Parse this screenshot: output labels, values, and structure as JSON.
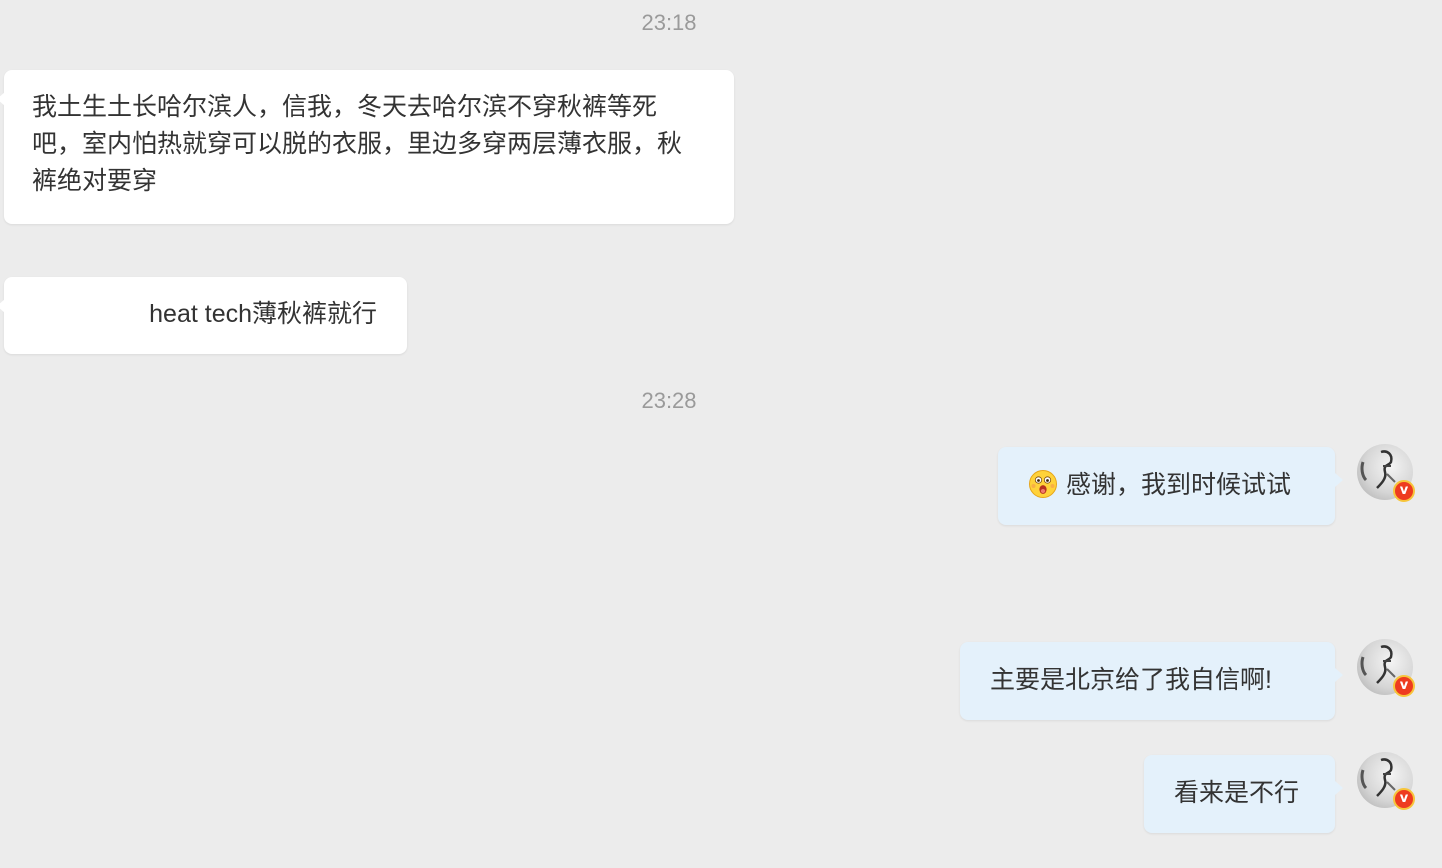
{
  "messages": [
    {
      "type": "timestamp",
      "text": "23:18"
    },
    {
      "type": "incoming",
      "text": "我土生土长哈尔滨人，信我，冬天去哈尔滨不穿秋裤等死吧，室内怕热就穿可以脱的衣服，里边多穿两层薄衣服，秋裤绝对要穿"
    },
    {
      "type": "incoming",
      "text": "heat tech薄秋裤就行"
    },
    {
      "type": "timestamp",
      "text": "23:28"
    },
    {
      "type": "outgoing",
      "emoji": "surprised-face-emoji",
      "text": "感谢，我到时候试试"
    },
    {
      "type": "outgoing",
      "text": "主要是北京给了我自信啊!"
    },
    {
      "type": "outgoing",
      "text": "看来是不行"
    }
  ],
  "avatar": {
    "badge": "v",
    "badge_color": "#ee3b1f",
    "badge_border": "#f7c53b"
  },
  "colors": {
    "background": "#ececec",
    "incoming_bubble": "#ffffff",
    "outgoing_bubble": "#e4f1fb",
    "timestamp_text": "#9a9a9a",
    "message_text": "#333333"
  }
}
